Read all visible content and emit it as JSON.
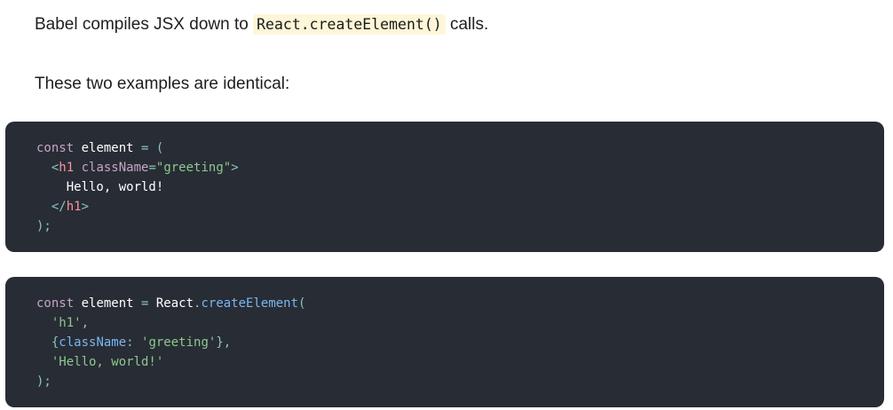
{
  "intro": {
    "before": "Babel compiles JSX down to ",
    "code": "React.createElement()",
    "after": " calls."
  },
  "examples_heading": "These two examples are identical:",
  "jsx_example": {
    "kw_const": "const",
    "var_name": " element ",
    "eq": "=",
    "open_paren": " (",
    "tag_open_lt": "  <",
    "tag_name": "h1",
    "attr_name": " className",
    "attr_eq": "=",
    "attr_value": "\"greeting\"",
    "tag_open_gt": ">",
    "text": "    Hello, world!",
    "tag_close_lt": "  </",
    "tag_close_name": "h1",
    "tag_close_gt": ">",
    "close": ");"
  },
  "create_example": {
    "kw_const": "const",
    "var_name": " element ",
    "eq": "=",
    "react": " React",
    "dot": ".",
    "fn": "createElement",
    "open_paren": "(",
    "arg1": "  'h1'",
    "comma1": ",",
    "brace_open": "  {",
    "prop": "className",
    "colon": ": ",
    "prop_value": "'greeting'",
    "brace_close": "},",
    "arg3": "  'Hello, world!'",
    "close": ");"
  }
}
